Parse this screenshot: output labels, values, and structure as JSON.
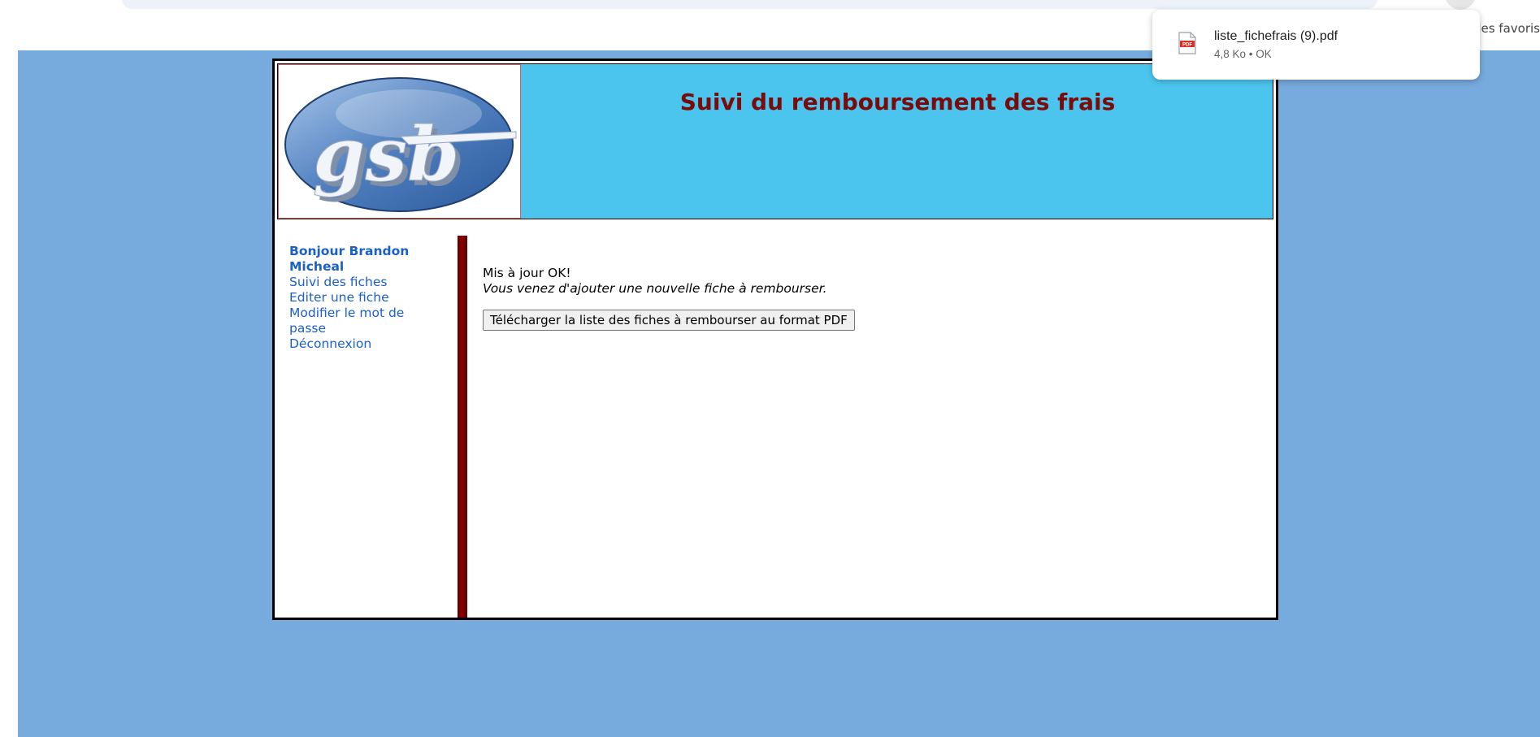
{
  "browser": {
    "bookmarks_fragment": "s les favoris"
  },
  "download": {
    "file_name": "liste_fichefrais (9).pdf",
    "status": "4,8 Ko • OK",
    "icon": "pdf-file-icon"
  },
  "header": {
    "logo_text": "gsb",
    "title": "Suivi du remboursement des frais"
  },
  "menu": {
    "greeting": "Bonjour Brandon Micheal",
    "items": [
      {
        "label": "Suivi des fiches"
      },
      {
        "label": "Editer une fiche"
      },
      {
        "label": "Modifier le mot de passe"
      },
      {
        "label": "Déconnexion"
      }
    ]
  },
  "content": {
    "status_message": "Mis à jour OK!",
    "info_message": "Vous venez d'ajouter une nouvelle fiche à rembourser.",
    "pdf_button_label": "Télécharger la liste des fiches à rembourser au format PDF"
  },
  "colors": {
    "page_background": "#77aadd",
    "header_background": "#4cc5ee",
    "title_color": "#7b0b0b",
    "menu_link_color": "#1b5fc9",
    "divider_color": "#7a0000"
  }
}
